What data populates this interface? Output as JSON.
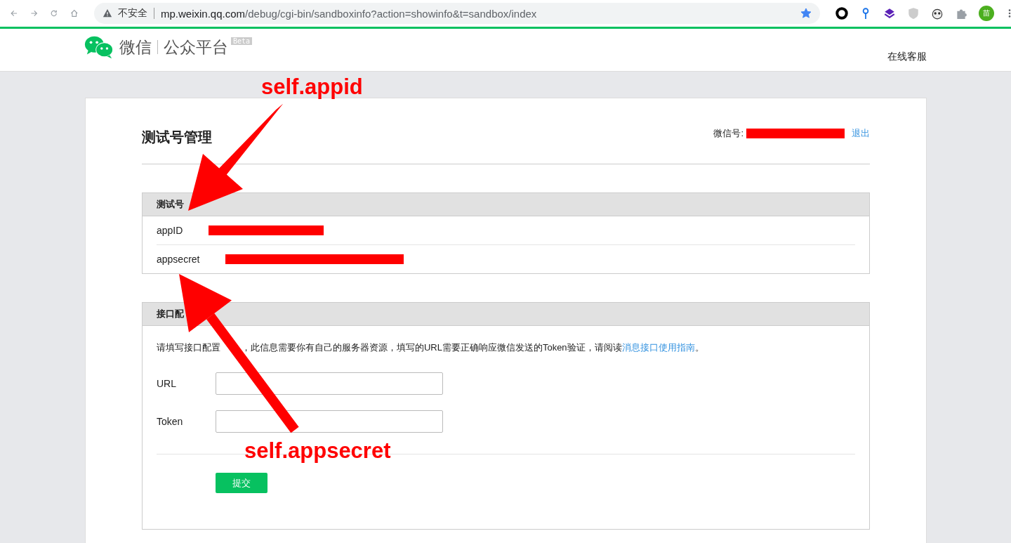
{
  "browser": {
    "insecure_label": "不安全",
    "url_host": "mp.weixin.qq.com",
    "url_path": "/debug/cgi-bin/sandboxinfo?action=showinfo&t=sandbox/index",
    "bookmarked": true,
    "profile_initial": "苗"
  },
  "header": {
    "logo_text": "微信",
    "platform": "公众平台",
    "badge": "Beta",
    "support_link": "在线客服"
  },
  "page": {
    "title": "测试号管理",
    "account_label": "微信号:",
    "logout": "退出"
  },
  "test_account": {
    "heading": "测试号",
    "rows": [
      {
        "label": "appID"
      },
      {
        "label": "appsecret"
      }
    ]
  },
  "interface": {
    "heading": "接口配",
    "description_parts": [
      "请填写接口配置",
      "，此信息需要你有自己的服务器资源，填写的URL需要正确响应微信发送的Token验证，请阅读"
    ],
    "guide_link": "消息接口使用指南",
    "description_end": "。",
    "fields": [
      {
        "label": "URL"
      },
      {
        "label": "Token"
      }
    ],
    "submit": "提交"
  },
  "annotations": [
    {
      "text": "self.appid"
    },
    {
      "text": "self.appsecret"
    }
  ]
}
